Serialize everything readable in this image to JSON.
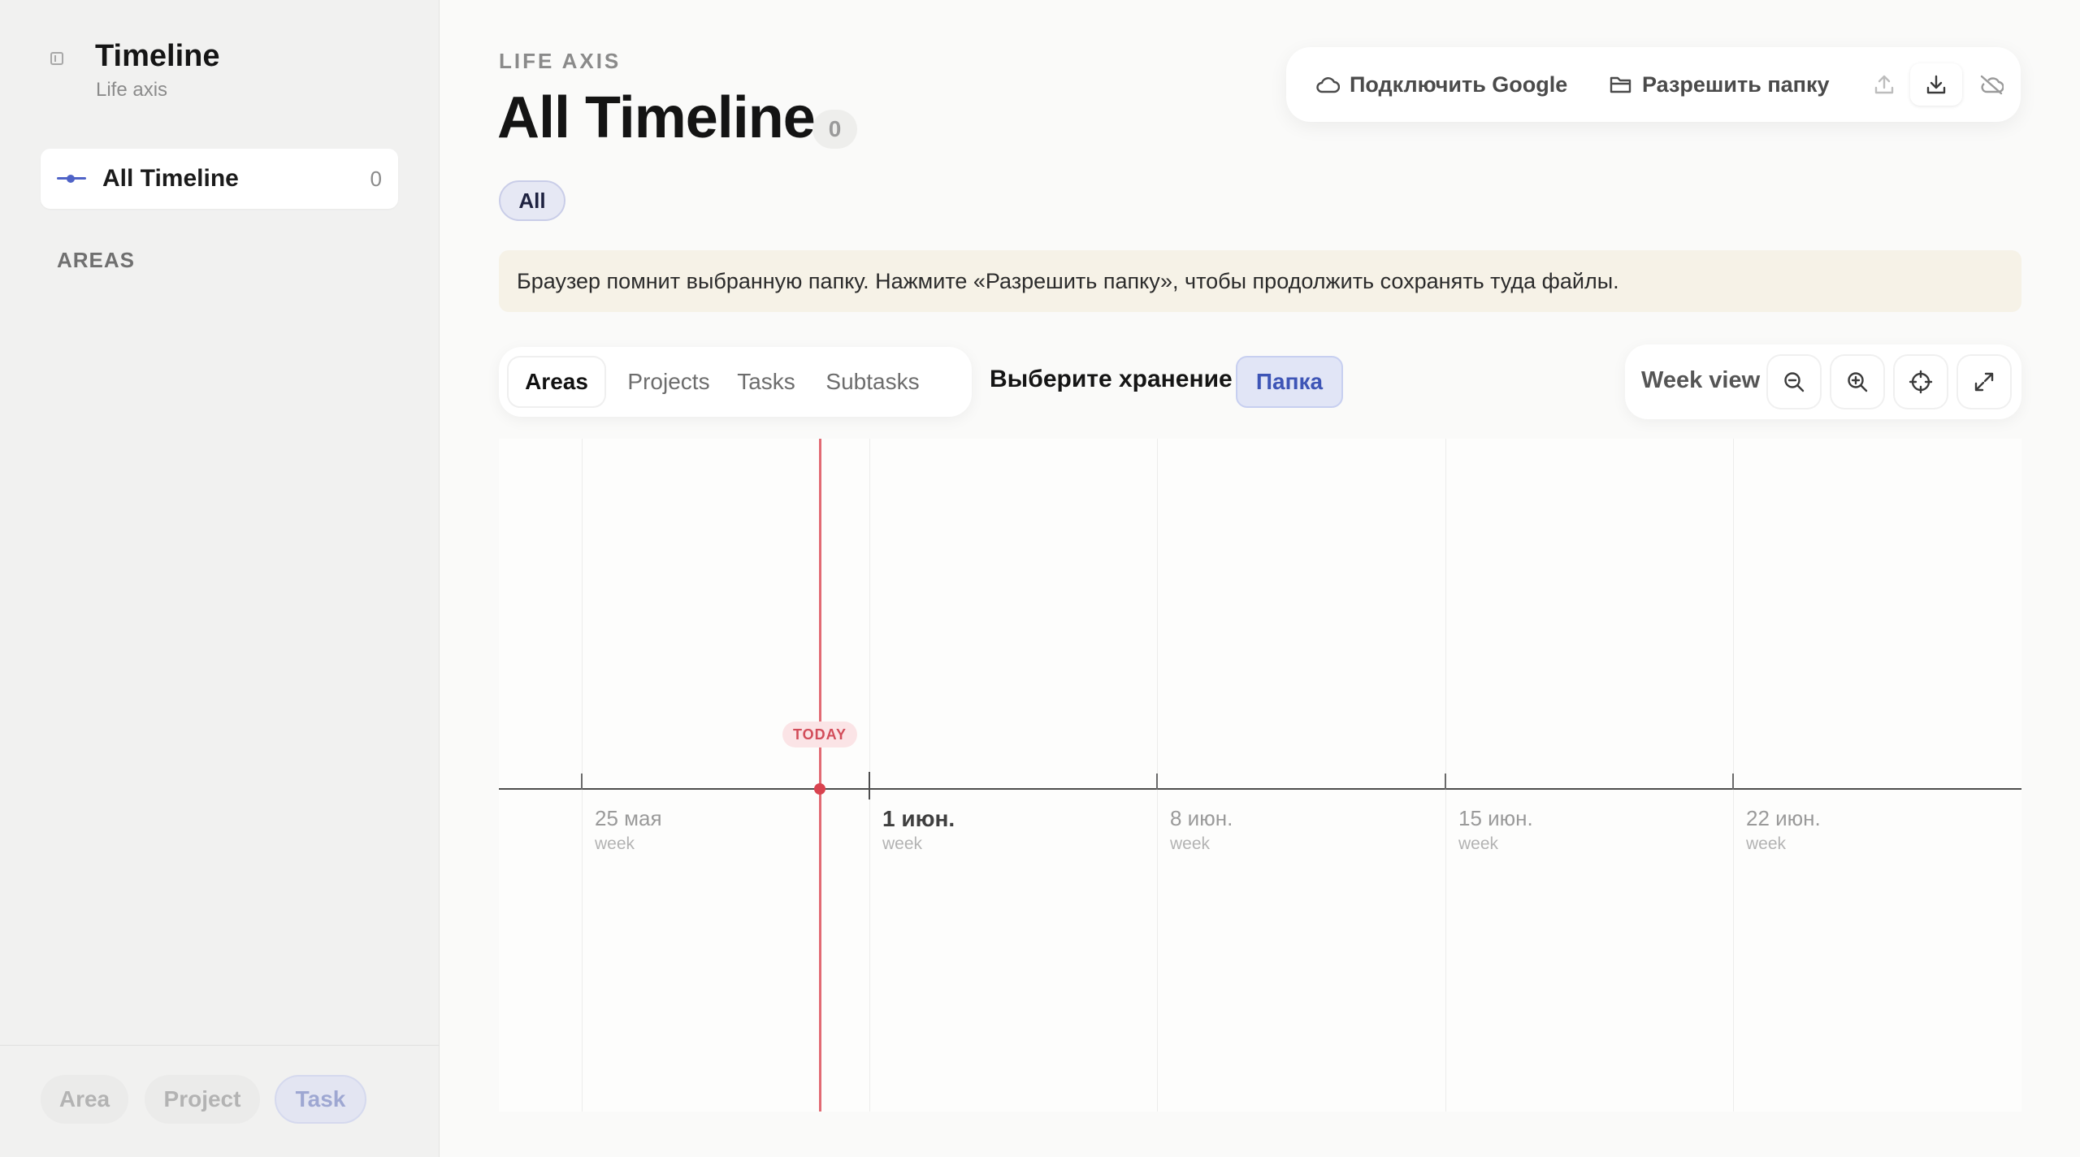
{
  "sidebar": {
    "title": "Timeline",
    "subtitle": "Life axis",
    "nav": {
      "label": "All Timeline",
      "count": "0"
    },
    "section_label": "AREAS",
    "footer_chips": [
      "Area",
      "Project",
      "Task"
    ]
  },
  "header": {
    "eyebrow": "LIFE AXIS",
    "title": "All Timeline",
    "count": "0",
    "filter": "All"
  },
  "top_actions": {
    "google_label": "Подключить Google",
    "folder_label": "Разрешить папку",
    "icons": [
      "upload-icon",
      "download-icon",
      "cloud-off-icon"
    ]
  },
  "notice": "Браузер помнит выбранную папку. Нажмите «Разрешить папку», чтобы продолжить сохранять туда файлы.",
  "tabs": [
    "Areas",
    "Projects",
    "Tasks",
    "Subtasks"
  ],
  "active_tab": "Areas",
  "storage": {
    "label": "Выберите хранение",
    "button": "Папка"
  },
  "view": {
    "label": "Week view",
    "icons": [
      "zoom-out-icon",
      "zoom-in-icon",
      "crosshair-icon",
      "expand-icon"
    ]
  },
  "timeline": {
    "today_label": "TODAY",
    "weeks": [
      {
        "label": "25 мая",
        "sub": "week"
      },
      {
        "label": "1 июн.",
        "sub": "week"
      },
      {
        "label": "8 июн.",
        "sub": "week"
      },
      {
        "label": "15 июн.",
        "sub": "week"
      },
      {
        "label": "22 июн.",
        "sub": "week"
      }
    ]
  },
  "colors": {
    "accent": "#4f63c7",
    "today": "#d9434f",
    "notice_bg": "#f6f2e7"
  }
}
